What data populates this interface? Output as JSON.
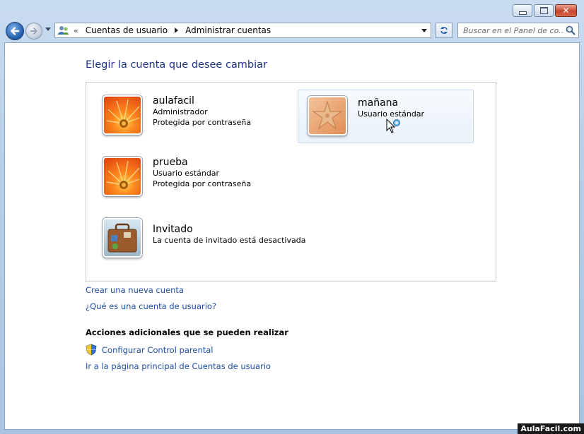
{
  "window": {
    "buttons": {
      "minimize": "minimize",
      "maximize": "maximize",
      "close": "close"
    }
  },
  "nav": {
    "chevron": "«",
    "breadcrumb": [
      "Cuentas de usuario",
      "Administrar cuentas"
    ],
    "search_placeholder": "Buscar en el Panel de co..."
  },
  "main": {
    "heading": "Elegir la cuenta que desee cambiar",
    "accounts": [
      {
        "name": "aulafacil",
        "lines": [
          "Administrador",
          "Protegida por contraseña"
        ],
        "picture": "flower"
      },
      {
        "name": "mañana",
        "lines": [
          "Usuario estándar"
        ],
        "picture": "starfish"
      },
      {
        "name": "prueba",
        "lines": [
          "Usuario estándar",
          "Protegida por contraseña"
        ],
        "picture": "flower"
      },
      {
        "name": "Invitado",
        "lines": [
          "La cuenta de invitado está desactivada"
        ],
        "picture": "suitcase"
      }
    ],
    "links": {
      "create_account": "Crear una nueva cuenta",
      "what_is_account": "¿Qué es una cuenta de usuario?"
    },
    "additional": {
      "title": "Acciones adicionales que se pueden realizar",
      "parental": "Configurar Control parental",
      "main_page": "Ir a la página principal de Cuentas de usuario"
    }
  },
  "watermark": "AulaFacil.com",
  "colors": {
    "link": "#1f4fa8",
    "heading": "#1e3287"
  }
}
